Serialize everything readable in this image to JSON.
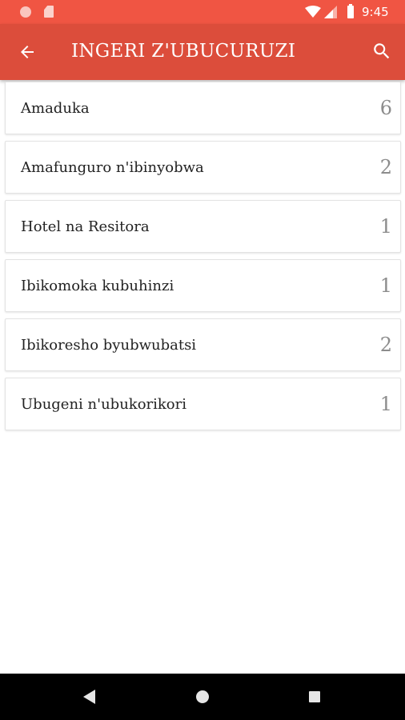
{
  "status_bar": {
    "time": "9:45",
    "icons": [
      "notification-dot-icon",
      "sd-card-icon",
      "wifi-icon",
      "signal-icon",
      "battery-icon"
    ]
  },
  "app_bar": {
    "title": "INGERI Z'UBUCURUZI",
    "back_icon": "arrow-left-icon",
    "search_icon": "search-icon",
    "color": "#dc4d3b"
  },
  "categories": [
    {
      "label": "Amaduka",
      "count": "6"
    },
    {
      "label": "Amafunguro n'ibinyobwa",
      "count": "2"
    },
    {
      "label": "Hotel na Resitora",
      "count": "1"
    },
    {
      "label": "Ibikomoka kubuhinzi",
      "count": "1"
    },
    {
      "label": "Ibikoresho byubwubatsi",
      "count": "2"
    },
    {
      "label": "Ubugeni n'ubukorikori",
      "count": "1"
    }
  ],
  "nav_bar": {
    "icons": [
      "nav-back-icon",
      "nav-home-icon",
      "nav-recents-icon"
    ]
  },
  "colors": {
    "status_bar": "#f05543",
    "app_bar": "#dc4d3b",
    "count_text": "#8c8c8c"
  }
}
